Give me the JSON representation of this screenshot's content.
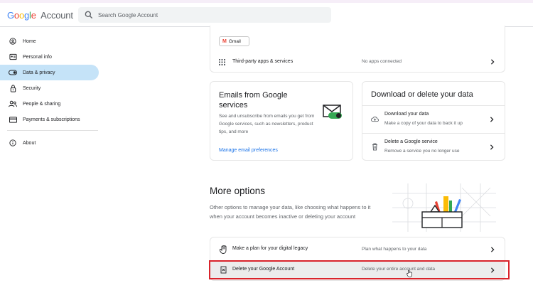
{
  "header": {
    "logo_letters": [
      "G",
      "o",
      "o",
      "g",
      "l",
      "e"
    ],
    "logo_suffix": "Account",
    "search_placeholder": "Search Google Account"
  },
  "sidebar": {
    "items": [
      {
        "label": "Home",
        "icon": "home-icon"
      },
      {
        "label": "Personal info",
        "icon": "id-card-icon"
      },
      {
        "label": "Data & privacy",
        "icon": "toggle-icon",
        "active": true
      },
      {
        "label": "Security",
        "icon": "lock-icon"
      },
      {
        "label": "People & sharing",
        "icon": "people-icon"
      },
      {
        "label": "Payments & subscriptions",
        "icon": "credit-card-icon"
      }
    ],
    "about": {
      "label": "About",
      "icon": "info-icon"
    }
  },
  "apps_card": {
    "chip_label": "Gmail",
    "third_party_label": "Third-party apps & services",
    "third_party_status": "No apps connected"
  },
  "emails_card": {
    "title": "Emails from Google services",
    "description": "See and unsubscribe from emails you get from Google services, such as newsletters, product tips, and more",
    "link": "Manage email preferences"
  },
  "download_card": {
    "title": "Download or delete your data",
    "download_title": "Download your data",
    "download_sub": "Make a copy of your data to back it up",
    "delete_service_title": "Delete a Google service",
    "delete_service_sub": "Remove a service you no longer use"
  },
  "more_options": {
    "title": "More options",
    "description": "Other options to manage your data, like choosing what happens to it when your account becomes inactive or deleting your account",
    "plan_title": "Make a plan for your digital legacy",
    "plan_sub": "Plan what happens to your data",
    "delete_account_title": "Delete your Google Account",
    "delete_account_sub": "Delete your entire account and data"
  },
  "colors": {
    "active_nav": "#c5e3f8",
    "link": "#1a73e8",
    "highlight_border": "#d9232b"
  }
}
